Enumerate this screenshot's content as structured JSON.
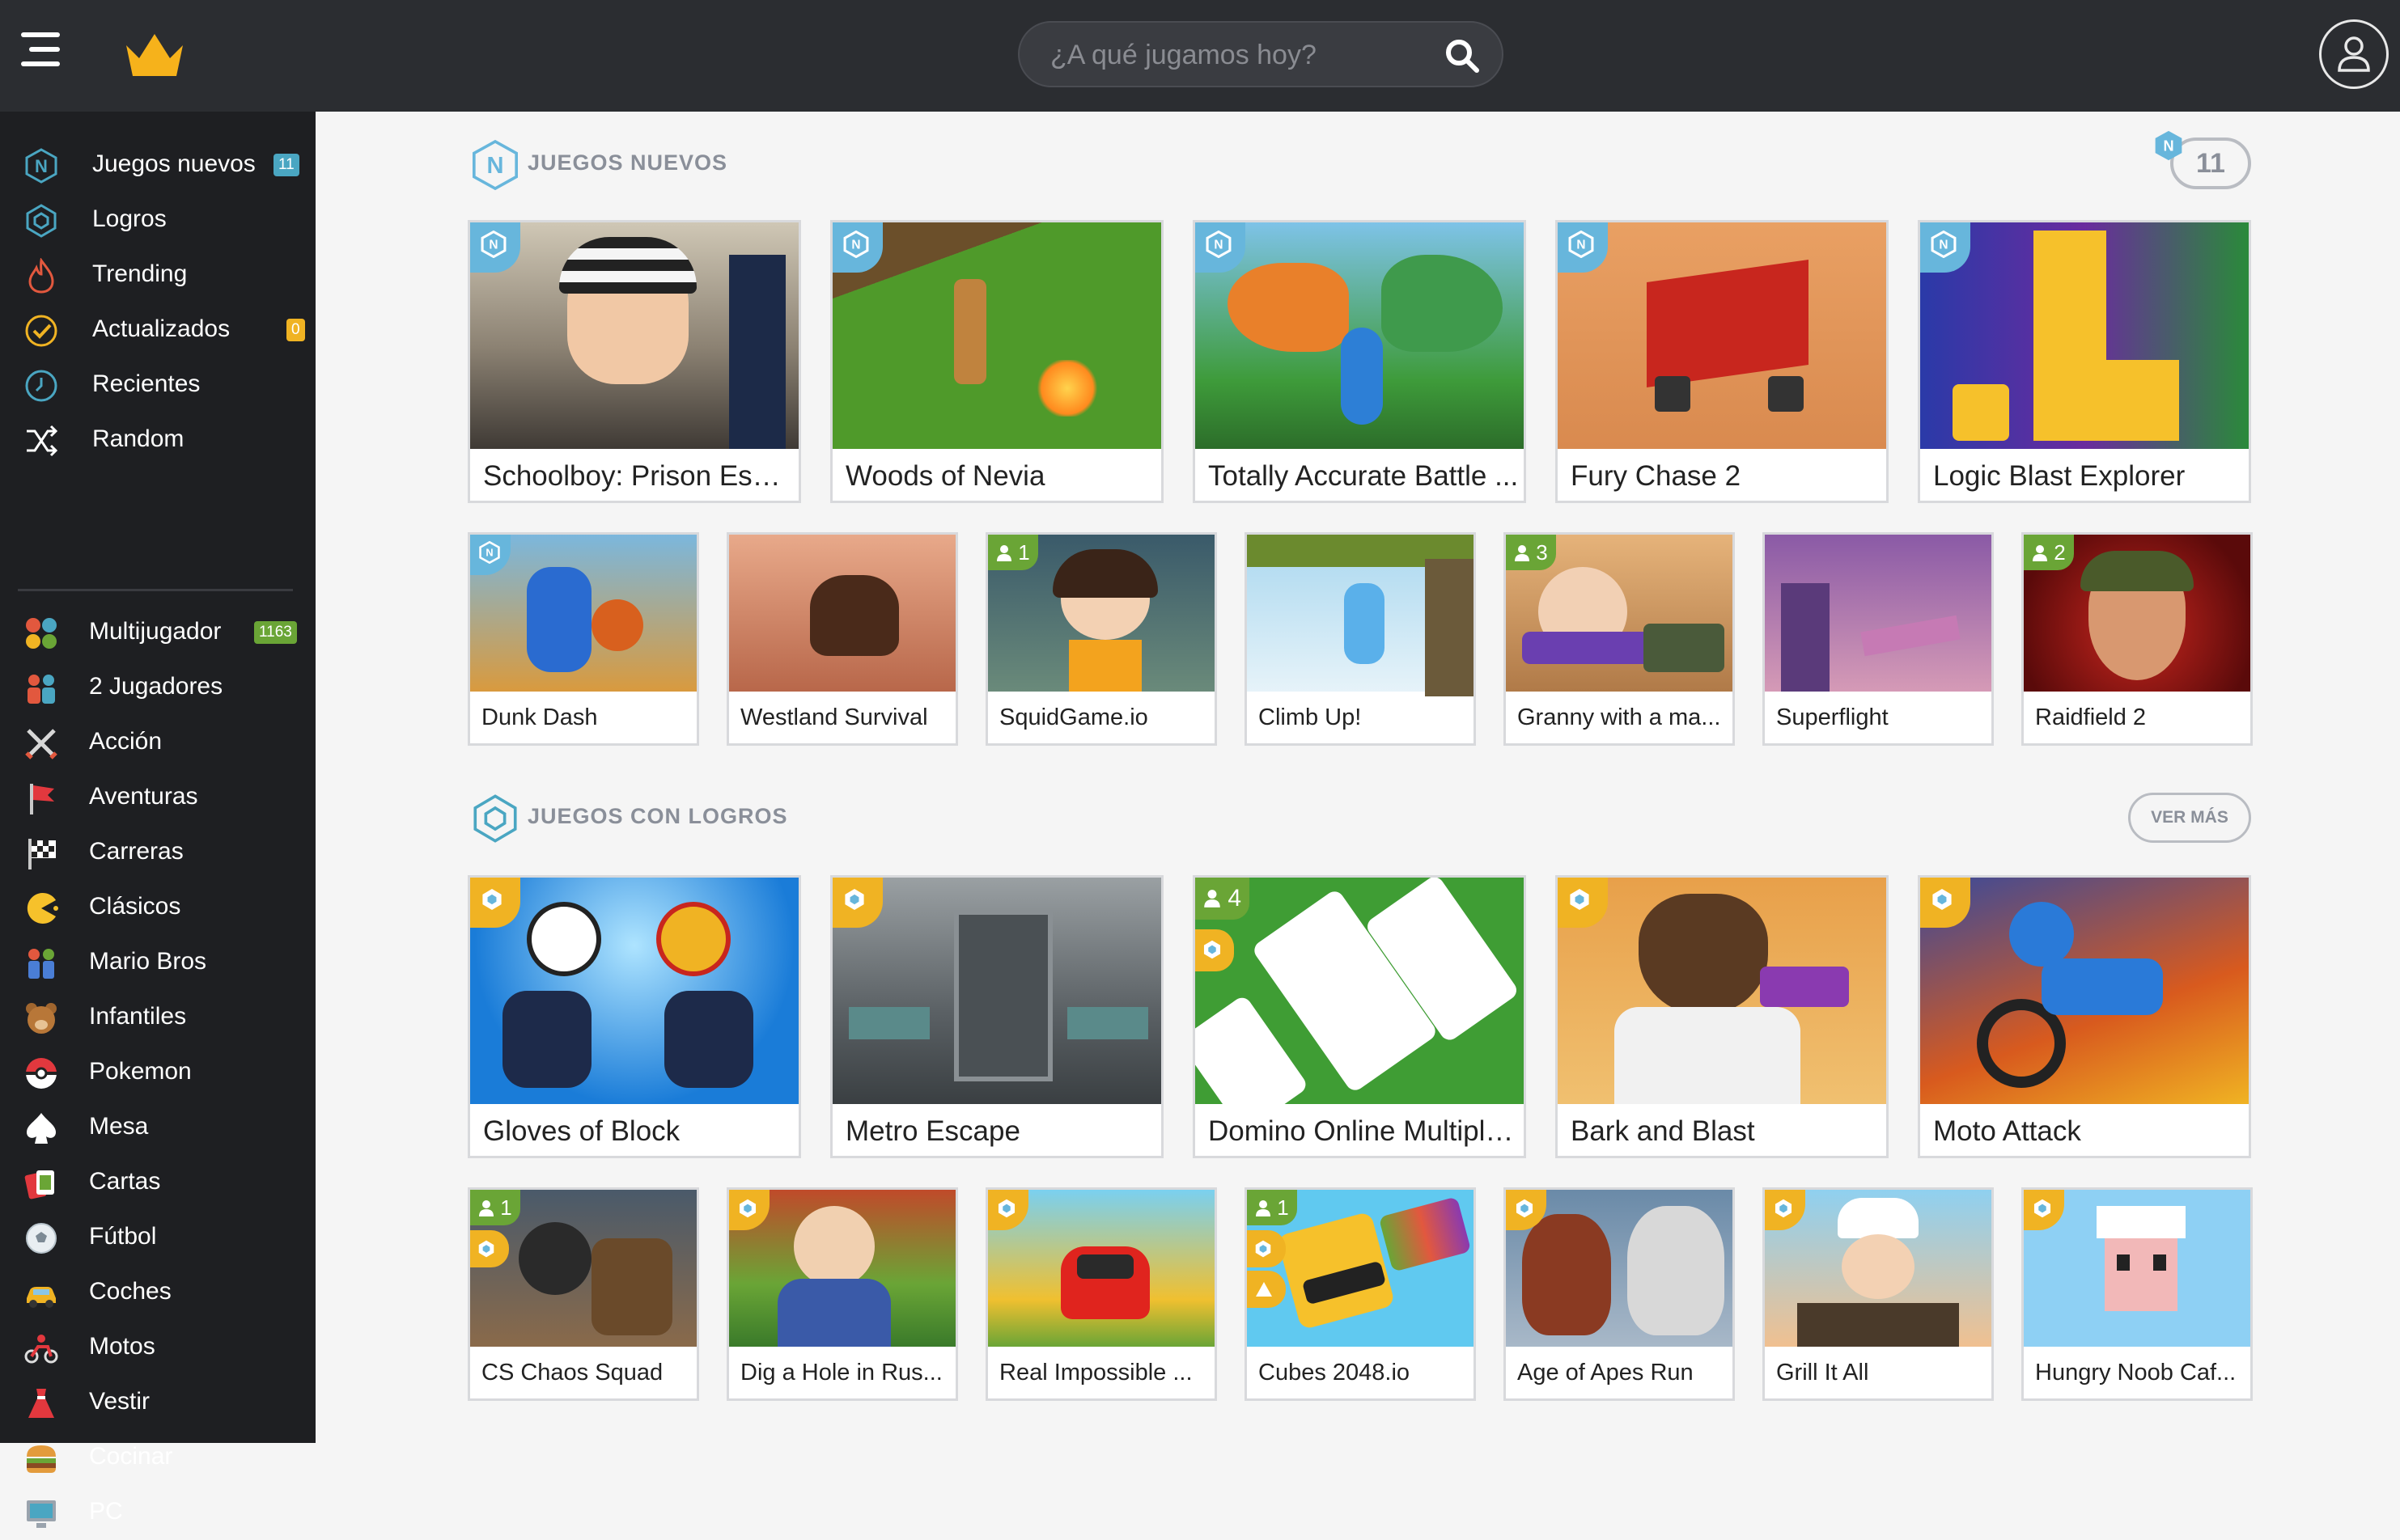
{
  "header": {
    "search_placeholder": "¿A qué jugamos hoy?"
  },
  "sidebar": {
    "main_items": [
      {
        "label": "Juegos nuevos",
        "badge": "11",
        "badge_color": "#4aa6c2"
      },
      {
        "label": "Logros"
      },
      {
        "label": "Trending"
      },
      {
        "label": "Actualizados",
        "badge": "0",
        "badge_color": "#f0b323"
      },
      {
        "label": "Recientes"
      },
      {
        "label": "Random"
      }
    ],
    "categories": [
      {
        "label": "Multijugador",
        "badge": "1163",
        "badge_color": "#6aa536"
      },
      {
        "label": "2 Jugadores"
      },
      {
        "label": "Acción"
      },
      {
        "label": "Aventuras"
      },
      {
        "label": "Carreras"
      },
      {
        "label": "Clásicos"
      },
      {
        "label": "Mario Bros"
      },
      {
        "label": "Infantiles"
      },
      {
        "label": "Pokemon"
      },
      {
        "label": "Mesa"
      },
      {
        "label": "Cartas"
      },
      {
        "label": "Fútbol"
      },
      {
        "label": "Coches"
      },
      {
        "label": "Motos"
      },
      {
        "label": "Vestir"
      },
      {
        "label": "Cocinar"
      },
      {
        "label": "PC"
      }
    ]
  },
  "sections": {
    "new": {
      "title": "JUEGOS NUEVOS",
      "count": "11",
      "large": [
        {
          "title": "Schoolboy: Prison Esca..."
        },
        {
          "title": "Woods of Nevia"
        },
        {
          "title": "Totally Accurate Battle ..."
        },
        {
          "title": "Fury Chase 2"
        },
        {
          "title": "Logic Blast Explorer"
        }
      ],
      "small": [
        {
          "title": "Dunk Dash"
        },
        {
          "title": "Westland Survival"
        },
        {
          "title": "SquidGame.io",
          "players": "1"
        },
        {
          "title": "Climb Up!"
        },
        {
          "title": "Granny with a ma...",
          "players": "3"
        },
        {
          "title": "Superflight"
        },
        {
          "title": "Raidfield 2",
          "players": "2"
        }
      ]
    },
    "achievements": {
      "title": "JUEGOS CON LOGROS",
      "more_label": "VER MÁS",
      "large": [
        {
          "title": "Gloves of Block"
        },
        {
          "title": "Metro Escape"
        },
        {
          "title": "Domino Online Multipla...",
          "players": "4"
        },
        {
          "title": "Bark and Blast"
        },
        {
          "title": "Moto Attack"
        }
      ],
      "small": [
        {
          "title": "CS Chaos Squad",
          "players": "1"
        },
        {
          "title": "Dig a Hole in Rus..."
        },
        {
          "title": "Real Impossible ..."
        },
        {
          "title": "Cubes 2048.io",
          "players": "1"
        },
        {
          "title": "Age of Apes Run"
        },
        {
          "title": "Grill It All"
        },
        {
          "title": "Hungry Noob Caf..."
        }
      ]
    }
  }
}
